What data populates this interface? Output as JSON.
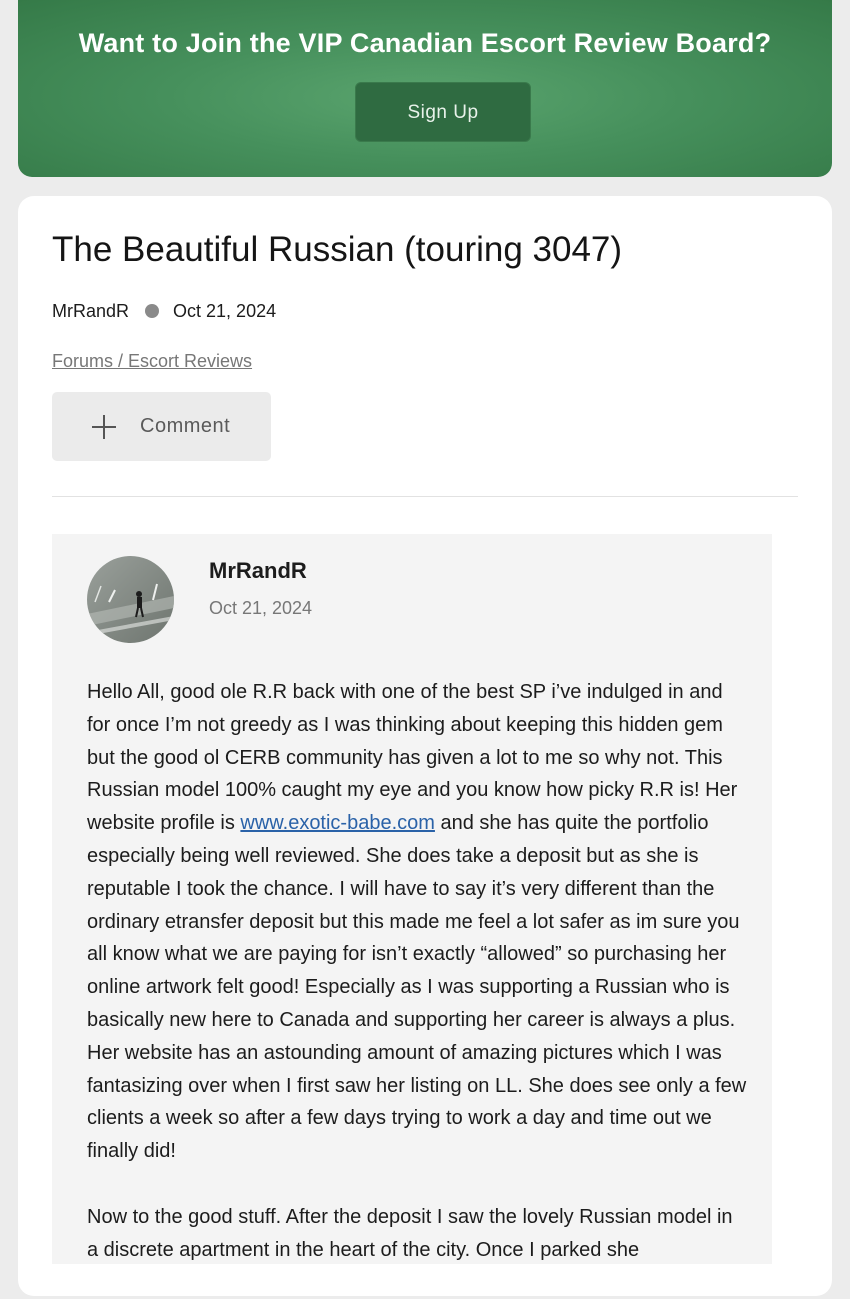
{
  "banner": {
    "title": "Want to Join the VIP Canadian Escort Review Board?",
    "signup_label": "Sign Up"
  },
  "thread": {
    "title": "The Beautiful Russian (touring 3047)",
    "author": "MrRandR",
    "date": "Oct 21, 2024",
    "breadcrumb": "Forums / Escort Reviews",
    "comment_label": "Comment"
  },
  "post": {
    "author": "MrRandR",
    "date": "Oct 21, 2024",
    "para1_before_link": "Hello All, good ole R.R back with one of the best SP i’ve indulged in and for once I’m not greedy as I was thinking about keeping this hidden gem but the good ol CERB community has given a lot to me so why not. This Russian model 100% caught my eye and you know how picky R.R is! Her website profile is ",
    "link_text": "www.exotic-babe.com",
    "para1_after_link": " and she has quite the portfolio especially being well reviewed. She does take a deposit but as she is reputable I took the chance. I will have to say it’s very different than the ordinary etransfer deposit but this made me feel a lot safer as im sure you all know what we are paying for isn’t exactly “allowed” so purchasing her online artwork felt good! Especially as I was supporting a Russian who is basically new here to Canada and supporting her career is always a plus. Her website has an astounding amount of amazing pictures which I was fantasizing over when I first saw her listing on LL. She does see only a few clients a week so after a few days trying to work a day and time out we finally did!",
    "para2": "Now to the good stuff. After the deposit I saw the lovely Russian model in a discrete apartment in the heart of the city. Once I parked she"
  },
  "colors": {
    "banner_green": "#46905c",
    "button_green": "#2f6b41",
    "link_blue": "#2a62a8"
  }
}
